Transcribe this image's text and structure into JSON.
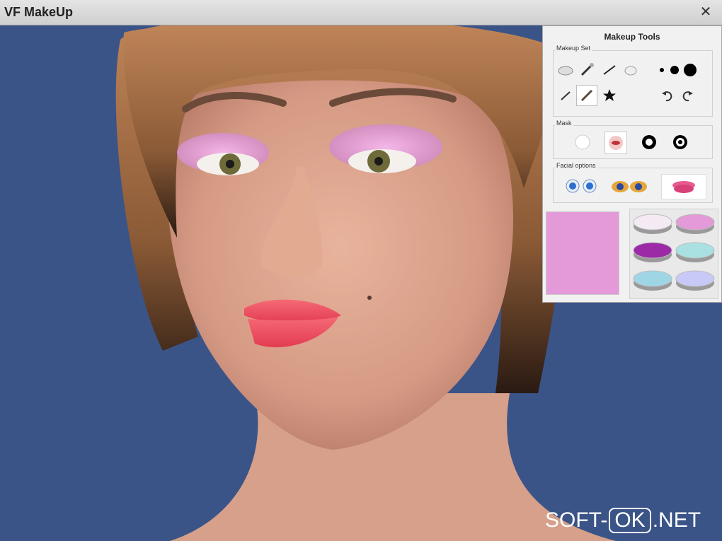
{
  "window": {
    "title": "VF MakeUp",
    "close_label": "✕"
  },
  "panel": {
    "title": "Makeup Tools",
    "makeup_set": {
      "label": "Makeup Set",
      "tools": [
        {
          "icon": "sponge-icon"
        },
        {
          "icon": "brush-icon"
        },
        {
          "icon": "liner-brush-icon"
        },
        {
          "icon": "powder-icon"
        },
        {
          "icon": "small-brush-icon"
        },
        {
          "icon": "pencil-icon",
          "selected": true
        },
        {
          "icon": "star-icon"
        }
      ],
      "brush_sizes": [
        "small-dot-icon",
        "medium-dot-icon",
        "large-dot-icon"
      ],
      "undo_icon": "undo-icon",
      "redo_icon": "redo-icon"
    },
    "mask": {
      "label": "Mask",
      "items": [
        "mask-none-icon",
        "mask-lips-icon",
        "mask-eye-ring-icon",
        "mask-eye-inner-icon"
      ]
    },
    "facial_options": {
      "label": "Facial options",
      "items": [
        "eye-color-icon",
        "eyes-icon",
        "lips-icon"
      ]
    },
    "current_color": "#e49ad8",
    "palette": [
      "#f4eaf4",
      "#e49ad8",
      "#9c2aa6",
      "#a9e0e2",
      "#9fd6e6",
      "#c9c9f8"
    ]
  },
  "watermark": {
    "left": "SOFT-",
    "box": "OK",
    "right": ".NET"
  }
}
